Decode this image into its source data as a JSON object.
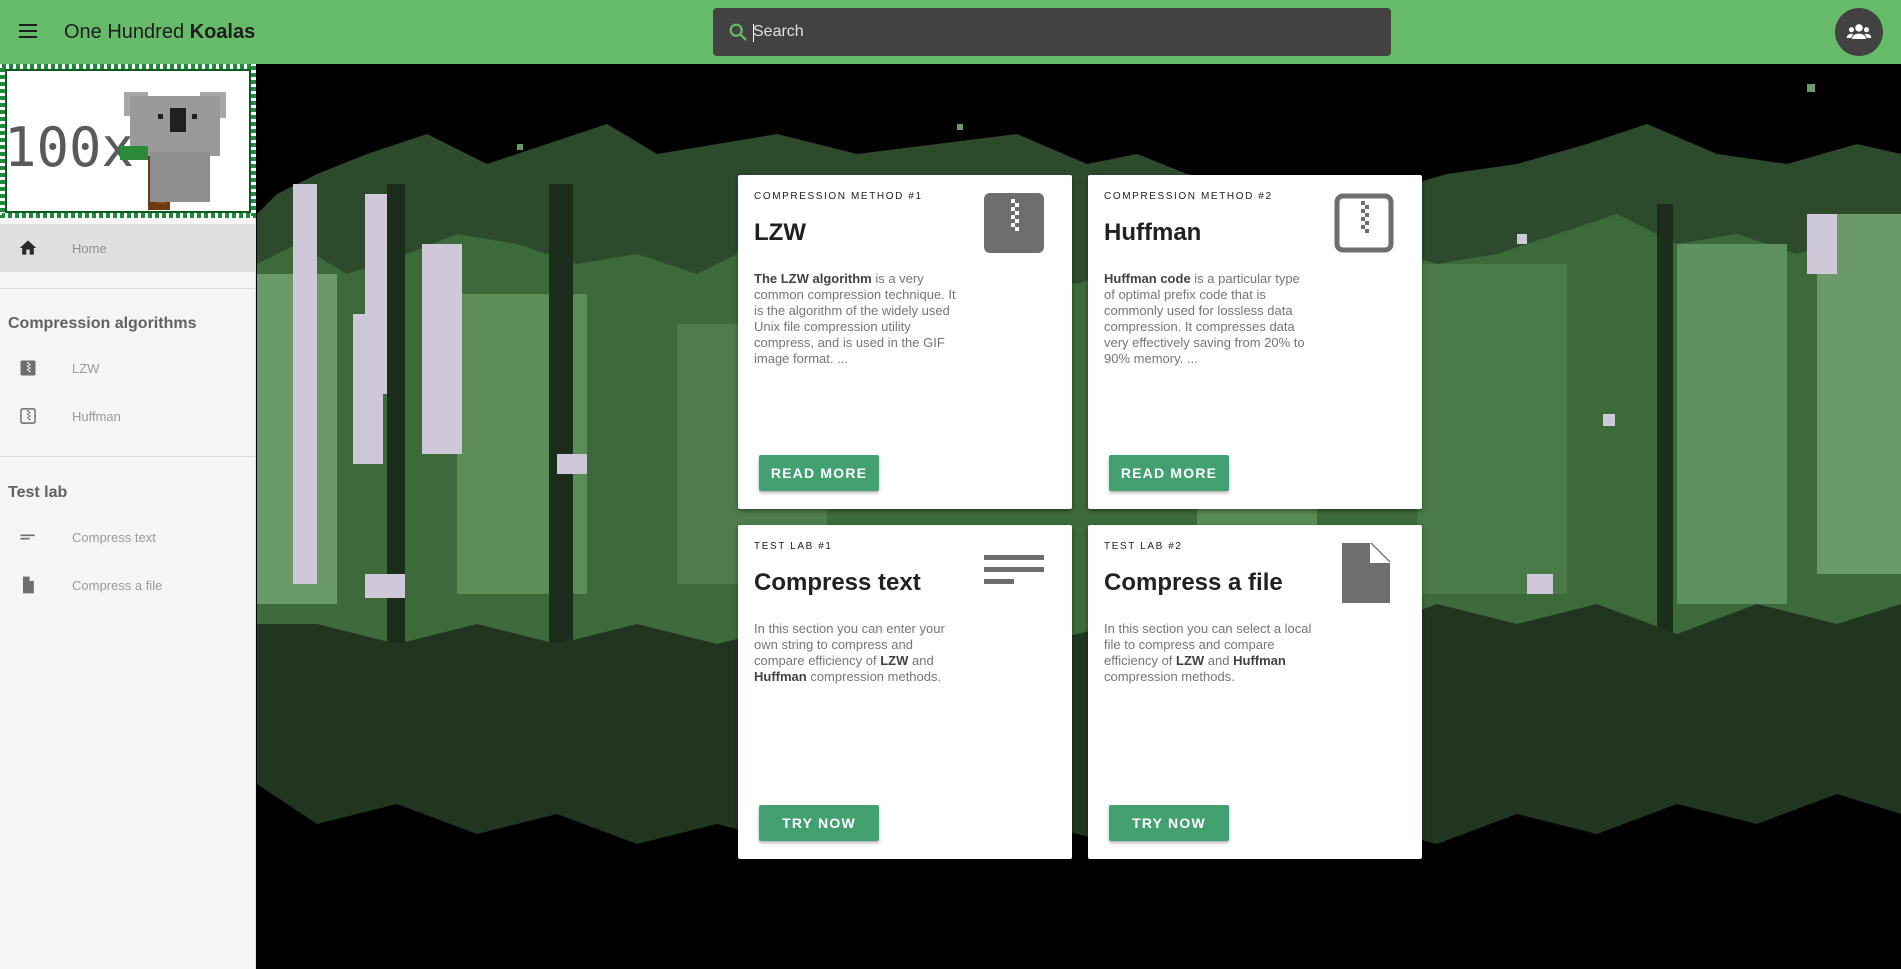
{
  "app": {
    "title_light": "One Hundred ",
    "title_bold": "Koalas"
  },
  "search": {
    "placeholder": "Search",
    "value": ""
  },
  "sidebar": {
    "logo_text": "100x",
    "home_label": "Home",
    "sections": [
      {
        "heading": "Compression algorithms",
        "items": [
          {
            "label": "LZW",
            "icon": "zip-icon"
          },
          {
            "label": "Huffman",
            "icon": "zip-box-icon"
          }
        ]
      },
      {
        "heading": "Test lab",
        "items": [
          {
            "label": "Compress text",
            "icon": "text-lines-icon"
          },
          {
            "label": "Compress a file",
            "icon": "file-icon"
          }
        ]
      }
    ]
  },
  "cards": [
    {
      "overline": "COMPRESSION METHOD #1",
      "title": "LZW",
      "text_bold": "The LZW algorithm",
      "text": " is a very common compression technique. It is the algorithm of the widely used Unix file compression utility compress, and is used in the GIF image format. ...",
      "button": "READ MORE",
      "icon": "zip-icon"
    },
    {
      "overline": "COMPRESSION METHOD #2",
      "title": "Huffman",
      "text_bold": "Huffman code",
      "text": " is a particular type of optimal prefix code that is commonly used for lossless data compression. It compresses data very effectively saving from 20% to 90% memory. ...",
      "button": "READ MORE",
      "icon": "zip-box-icon"
    },
    {
      "overline": "TEST LAB #1",
      "title": "Compress text",
      "text_a": "In this section you can enter your own string to compress and compare efficiency of ",
      "text_b1": "LZW",
      "text_mid": " and ",
      "text_b2": "Huffman",
      "text_c": " compression methods.",
      "button": "TRY NOW",
      "icon": "text-lines-icon"
    },
    {
      "overline": "TEST LAB #2",
      "title": "Compress a file",
      "text_a": "In this section you can select a local file to compress and compare efficiency of ",
      "text_b1": "LZW",
      "text_mid": " and ",
      "text_b2": "Huffman",
      "text_c": " compression methods.",
      "button": "TRY NOW",
      "icon": "file-icon"
    }
  ],
  "colors": {
    "topbar": "#66bb6a",
    "button": "#43a070",
    "forest_dark": "#2e4a2c",
    "forest_mid": "#3d6a3a",
    "forest_light": "#6a9a68",
    "birch": "#cfc8d8"
  }
}
